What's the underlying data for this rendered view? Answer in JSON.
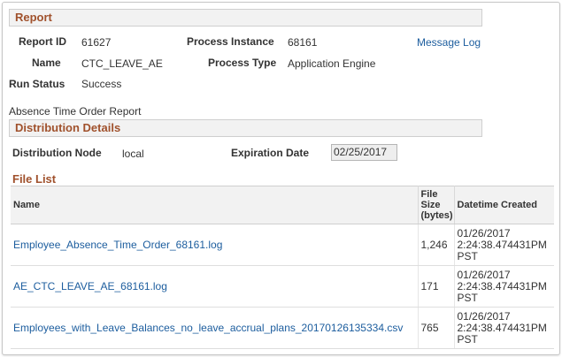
{
  "report_section": {
    "header": "Report",
    "report_id_label": "Report ID",
    "report_id": "61627",
    "process_instance_label": "Process Instance",
    "process_instance": "68161",
    "message_log_link": "Message Log",
    "name_label": "Name",
    "name": "CTC_LEAVE_AE",
    "process_type_label": "Process Type",
    "process_type": "Application Engine",
    "run_status_label": "Run Status",
    "run_status": "Success",
    "description": "Absence Time Order Report"
  },
  "distribution_section": {
    "header": "Distribution Details",
    "node_label": "Distribution Node",
    "node": "local",
    "expiration_label": "Expiration Date",
    "expiration_date": "02/25/2017"
  },
  "file_list": {
    "title": "File List",
    "columns": {
      "name": "Name",
      "size_line1": "File",
      "size_line2": "Size",
      "size_line3": "(bytes)",
      "datetime": "Datetime Created"
    },
    "rows": [
      {
        "name": "Employee_Absence_Time_Order_68161.log",
        "size": "1,246",
        "dt_line1": "01/26/2017",
        "dt_line2": "2:24:38.474431PM",
        "dt_line3": "PST"
      },
      {
        "name": "AE_CTC_LEAVE_AE_68161.log",
        "size": "171",
        "dt_line1": "01/26/2017",
        "dt_line2": "2:24:38.474431PM",
        "dt_line3": "PST"
      },
      {
        "name": "Employees_with_Leave_Balances_no_leave_accrual_plans_20170126135334.csv",
        "size": "765",
        "dt_line1": "01/26/2017",
        "dt_line2": "2:24:38.474431PM",
        "dt_line3": "PST"
      }
    ]
  },
  "colors": {
    "section_title": "#a0512c",
    "link": "#1c5d9e",
    "header_bg": "#f2f2f2"
  }
}
